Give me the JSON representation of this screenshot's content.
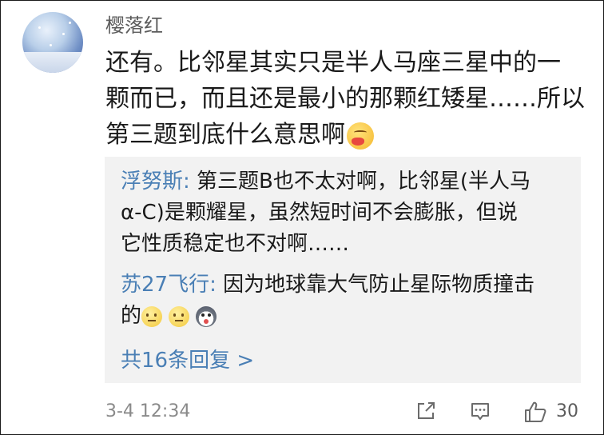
{
  "comment": {
    "username": "樱落红",
    "lines": [
      "还有。比邻星其实只是半人马座三星中的一",
      "颗而已，而且还是最小的那颗红矮星……所以",
      "第三题到底什么意思啊"
    ],
    "timestamp": "3-4 12:34",
    "like_count": "30"
  },
  "replies": [
    {
      "author": "浮努斯:",
      "lines": [
        " 第三题B也不太对啊，比邻星(半人马",
        "α-C)是颗耀星，虽然短时间不会膨胀，但说",
        "它性质稳定也不对啊……"
      ]
    },
    {
      "author": "苏27飞行:",
      "lines": [
        " 因为地球靠大气防止星际物质撞击",
        "的"
      ]
    }
  ],
  "more_replies_label": "共16条回复 >",
  "icons": {
    "avatar": "avatar",
    "emoji_post": "drooling-face-emoji",
    "emoji_reply": [
      "neutral-face-emoji",
      "neutral-face-emoji",
      "husky-dog-emoji"
    ],
    "share": "share-icon",
    "comment": "comment-icon",
    "like": "thumbs-up-icon"
  },
  "colors": {
    "link": "#4a7fb5",
    "reply_bg": "#f2f2f2",
    "meta": "#8a8a8a"
  }
}
